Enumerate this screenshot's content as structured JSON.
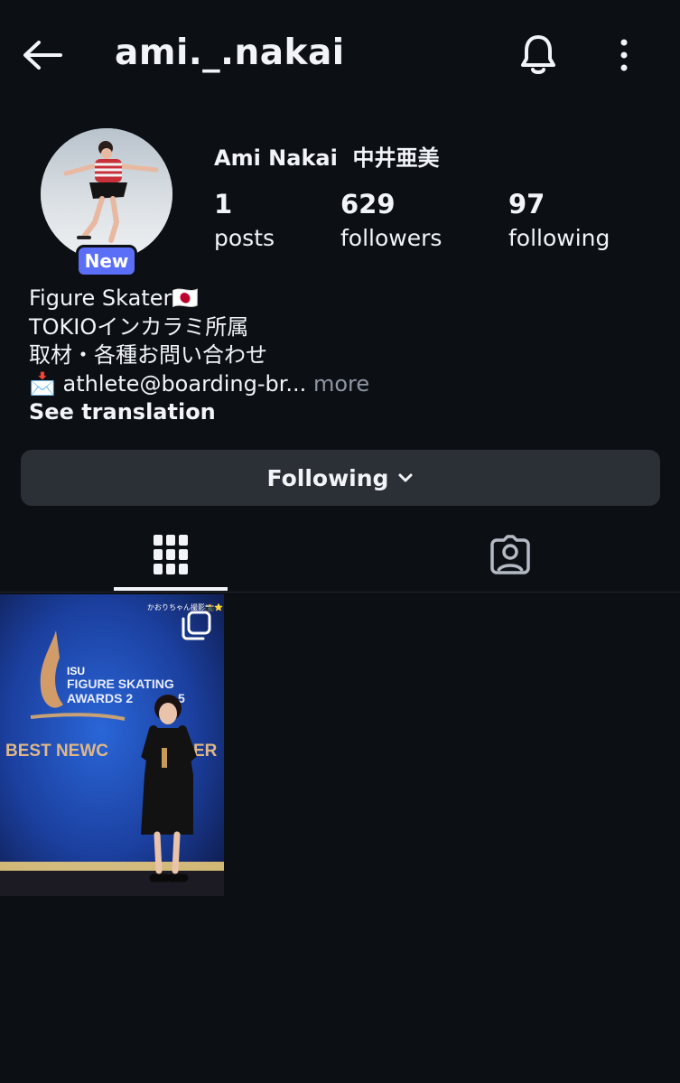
{
  "header": {
    "username": "ami._.nakai",
    "back_icon": "arrow-left-icon",
    "bell_icon": "bell-icon",
    "more_icon": "more-vertical-icon"
  },
  "profile": {
    "display_name": "Ami Nakai  中井亜美",
    "badge": "New",
    "stats": [
      {
        "value": "1",
        "label": "posts"
      },
      {
        "value": "629",
        "label": "followers"
      },
      {
        "value": "97",
        "label": "following"
      }
    ],
    "bio": {
      "line1": "Figure Skater🇯🇵",
      "line2": "TOKIOインカラミ所属",
      "line3": "取材・各種お問い合わせ",
      "line4": "📩 athlete@boarding-br...",
      "more": " more",
      "see_translation": "See translation"
    }
  },
  "actions": {
    "following_label": "Following"
  },
  "tabs": [
    {
      "name": "grid",
      "icon": "grid-icon",
      "active": true
    },
    {
      "name": "tagged",
      "icon": "tagged-person-icon",
      "active": false
    }
  ],
  "posts": [
    {
      "overlay_text": "かおりちゃん撮影📸⭐",
      "isu": "ISU",
      "award_line1": "FIGURE SKATING",
      "award_line2": "AWARDS 2",
      "award_line2b": "5",
      "best": "BEST NEWC",
      "best2": "ER",
      "multi_icon": "carousel-icon"
    }
  ],
  "colors": {
    "background": "#0c0f14",
    "button": "#2b2f36",
    "badge": "#5b6ef7",
    "muted": "#8e96a3"
  }
}
